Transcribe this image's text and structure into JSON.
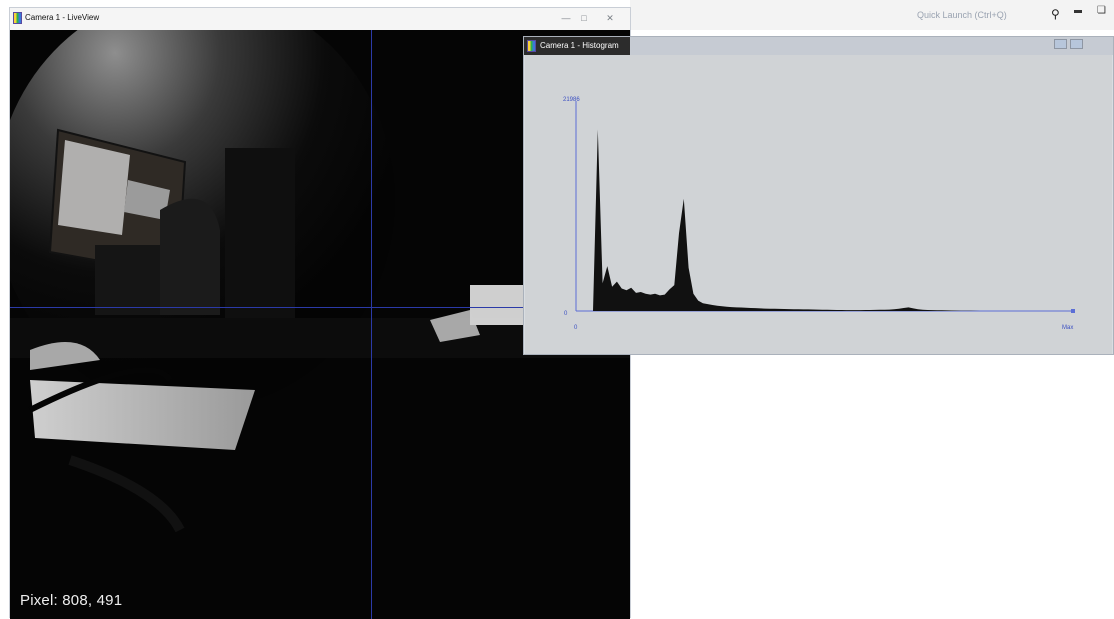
{
  "background_app": {
    "quick_launch": "Quick Launch (Ctrl+Q)"
  },
  "liveview": {
    "title": "Camera 1 - LiveView",
    "pixel_readout": "Pixel: 808, 491"
  },
  "histogram": {
    "title": "Camera 1 - Histogram",
    "y_max_label": "21986",
    "y_min_label": "0",
    "x_min_label": "0",
    "x_max_label": "Max"
  },
  "chart_data": {
    "type": "area",
    "x": [
      0,
      1,
      2,
      3,
      4,
      5,
      6,
      7,
      8,
      9,
      10,
      11,
      12,
      13,
      14,
      15,
      16,
      17,
      18,
      19,
      20,
      21,
      22,
      23,
      24,
      25,
      26,
      27,
      28,
      29,
      30,
      31,
      32,
      33,
      34,
      35,
      36,
      37,
      38,
      39,
      40,
      41,
      42,
      43,
      44,
      45,
      46,
      47,
      48,
      49,
      50,
      51,
      52,
      53,
      54,
      55,
      56,
      57,
      58,
      59,
      60,
      61,
      62,
      63,
      64,
      65,
      66,
      67,
      68,
      69,
      70,
      71,
      72,
      73,
      74,
      75,
      76,
      77,
      78,
      79,
      80,
      81,
      82,
      83,
      84,
      85,
      86,
      87,
      88,
      89,
      90,
      91,
      92,
      93,
      94,
      95,
      96,
      97,
      98,
      99,
      100
    ],
    "values": [
      0,
      21000,
      3200,
      5200,
      2800,
      3400,
      2600,
      2400,
      2700,
      2100,
      2200,
      2000,
      1900,
      2000,
      1800,
      1900,
      2500,
      3000,
      9000,
      13000,
      5000,
      2000,
      1200,
      900,
      800,
      700,
      600,
      550,
      500,
      450,
      420,
      400,
      380,
      350,
      330,
      300,
      280,
      260,
      250,
      240,
      230,
      220,
      210,
      200,
      190,
      180,
      170,
      160,
      150,
      140,
      130,
      120,
      110,
      100,
      100,
      100,
      100,
      110,
      120,
      130,
      140,
      150,
      160,
      200,
      250,
      350,
      420,
      300,
      200,
      150,
      120,
      100,
      90,
      80,
      70,
      60,
      50,
      40,
      30,
      20,
      10,
      0,
      0,
      0,
      0,
      0,
      0,
      0,
      0,
      0,
      0,
      0,
      0,
      0,
      0,
      0,
      0,
      0,
      0,
      0,
      0
    ],
    "ylim": [
      0,
      21986
    ],
    "color": "#111111"
  }
}
